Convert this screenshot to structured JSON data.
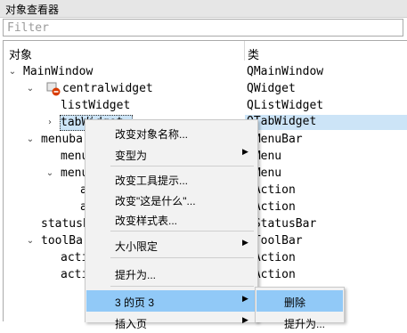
{
  "window": {
    "title": "对象查看器"
  },
  "filter": {
    "placeholder": "Filter",
    "value": ""
  },
  "tree": {
    "headers": {
      "object": "对象",
      "class": "类"
    },
    "rows": [
      {
        "name": "MainWindow",
        "class": "QMainWindow",
        "expanded": true
      },
      {
        "name": "centralwidget",
        "class": "QWidget",
        "expanded": true,
        "icon": "warning-icon"
      },
      {
        "name": "listWidget",
        "class": "QListWidget"
      },
      {
        "name": "tabWidget",
        "class": "QTabWidget",
        "selected": true,
        "expanded": false
      },
      {
        "name": "menubar",
        "class": "QMenuBar",
        "expanded": true
      },
      {
        "name": "menu",
        "class": "QMenu"
      },
      {
        "name": "menu",
        "class": "QMenu",
        "expanded": true
      },
      {
        "name": "action",
        "class": "QAction"
      },
      {
        "name": "action",
        "class": "QAction"
      },
      {
        "name": "statusbar",
        "class": "QStatusBar"
      },
      {
        "name": "toolBar",
        "class": "QToolBar",
        "expanded": true
      },
      {
        "name": "action",
        "class": "QAction"
      },
      {
        "name": "action",
        "class": "QAction"
      }
    ]
  },
  "context_menu": {
    "items": [
      {
        "label": "改变对象名称..."
      },
      {
        "label": "变型为",
        "submenu": true
      },
      {
        "label": "改变工具提示..."
      },
      {
        "label": "改变\"这是什么\"..."
      },
      {
        "label": "改变样式表..."
      },
      {
        "label": "大小限定",
        "submenu": true
      },
      {
        "label": "提升为..."
      },
      {
        "label": "3 的页 3",
        "submenu": true,
        "highlighted": true
      },
      {
        "label": "插入页",
        "submenu": true
      }
    ]
  },
  "submenu": {
    "items": [
      {
        "label": "删除",
        "highlighted": true
      },
      {
        "label": "提升为..."
      }
    ]
  },
  "colors": {
    "selection": "#cce4f7",
    "menu_highlight": "#91c9f7",
    "warning": "#d83b01"
  }
}
